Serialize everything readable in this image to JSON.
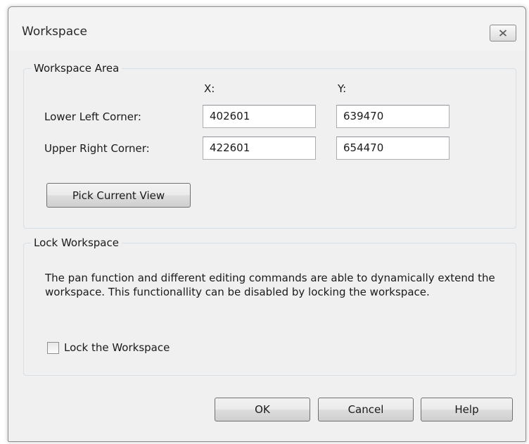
{
  "dialog": {
    "title": "Workspace",
    "close_icon": "close-icon"
  },
  "workspace_area": {
    "legend": "Workspace Area",
    "x_header": "X:",
    "y_header": "Y:",
    "lower_left_label": "Lower Left Corner:",
    "lower_left_x": "402601",
    "lower_left_y": "639470",
    "upper_right_label": "Upper Right Corner:",
    "upper_right_x": "422601",
    "upper_right_y": "654470",
    "pick_button": "Pick Current View"
  },
  "lock_workspace": {
    "legend": "Lock Workspace",
    "description": "The pan function and different editing commands are able to dynamically extend the workspace. This functionallity can be disabled by locking the workspace.",
    "checkbox_label": "Lock the Workspace",
    "checked": false
  },
  "buttons": {
    "ok": "OK",
    "cancel": "Cancel",
    "help": "Help"
  }
}
